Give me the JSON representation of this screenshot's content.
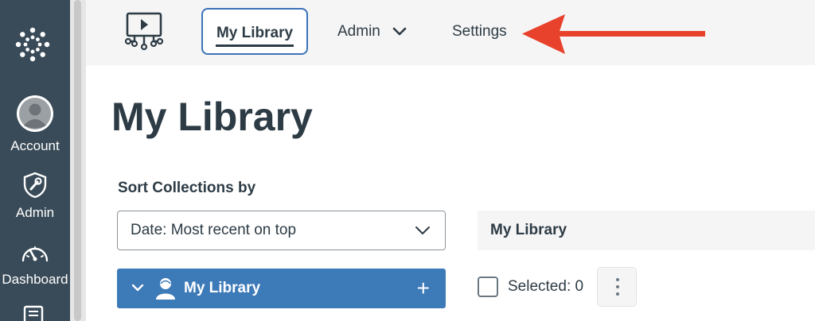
{
  "global_nav": {
    "logo": "canvas-logo-icon",
    "items": [
      {
        "label": "Account",
        "icon": "avatar-icon"
      },
      {
        "label": "Admin",
        "icon": "shield-wrench-icon"
      },
      {
        "label": "Dashboard",
        "icon": "speedometer-icon"
      }
    ]
  },
  "topbar": {
    "app_icon": "video-network-icon",
    "tabs": [
      {
        "label": "My Library",
        "active": true
      },
      {
        "label": "Admin",
        "has_dropdown": true
      },
      {
        "label": "Settings"
      }
    ],
    "annotation_arrow_color": "#e8412c"
  },
  "main": {
    "page_title": "My Library",
    "sort": {
      "label": "Sort Collections by",
      "selected": "Date: Most recent on top"
    },
    "collection": {
      "label": "My Library",
      "color": "#3d7ab8"
    },
    "panel": {
      "header": "My Library",
      "selected_text": "Selected: 0"
    }
  },
  "colors": {
    "nav_bg": "#394b58",
    "accent": "#3b73b9",
    "text": "#2d3b45"
  }
}
